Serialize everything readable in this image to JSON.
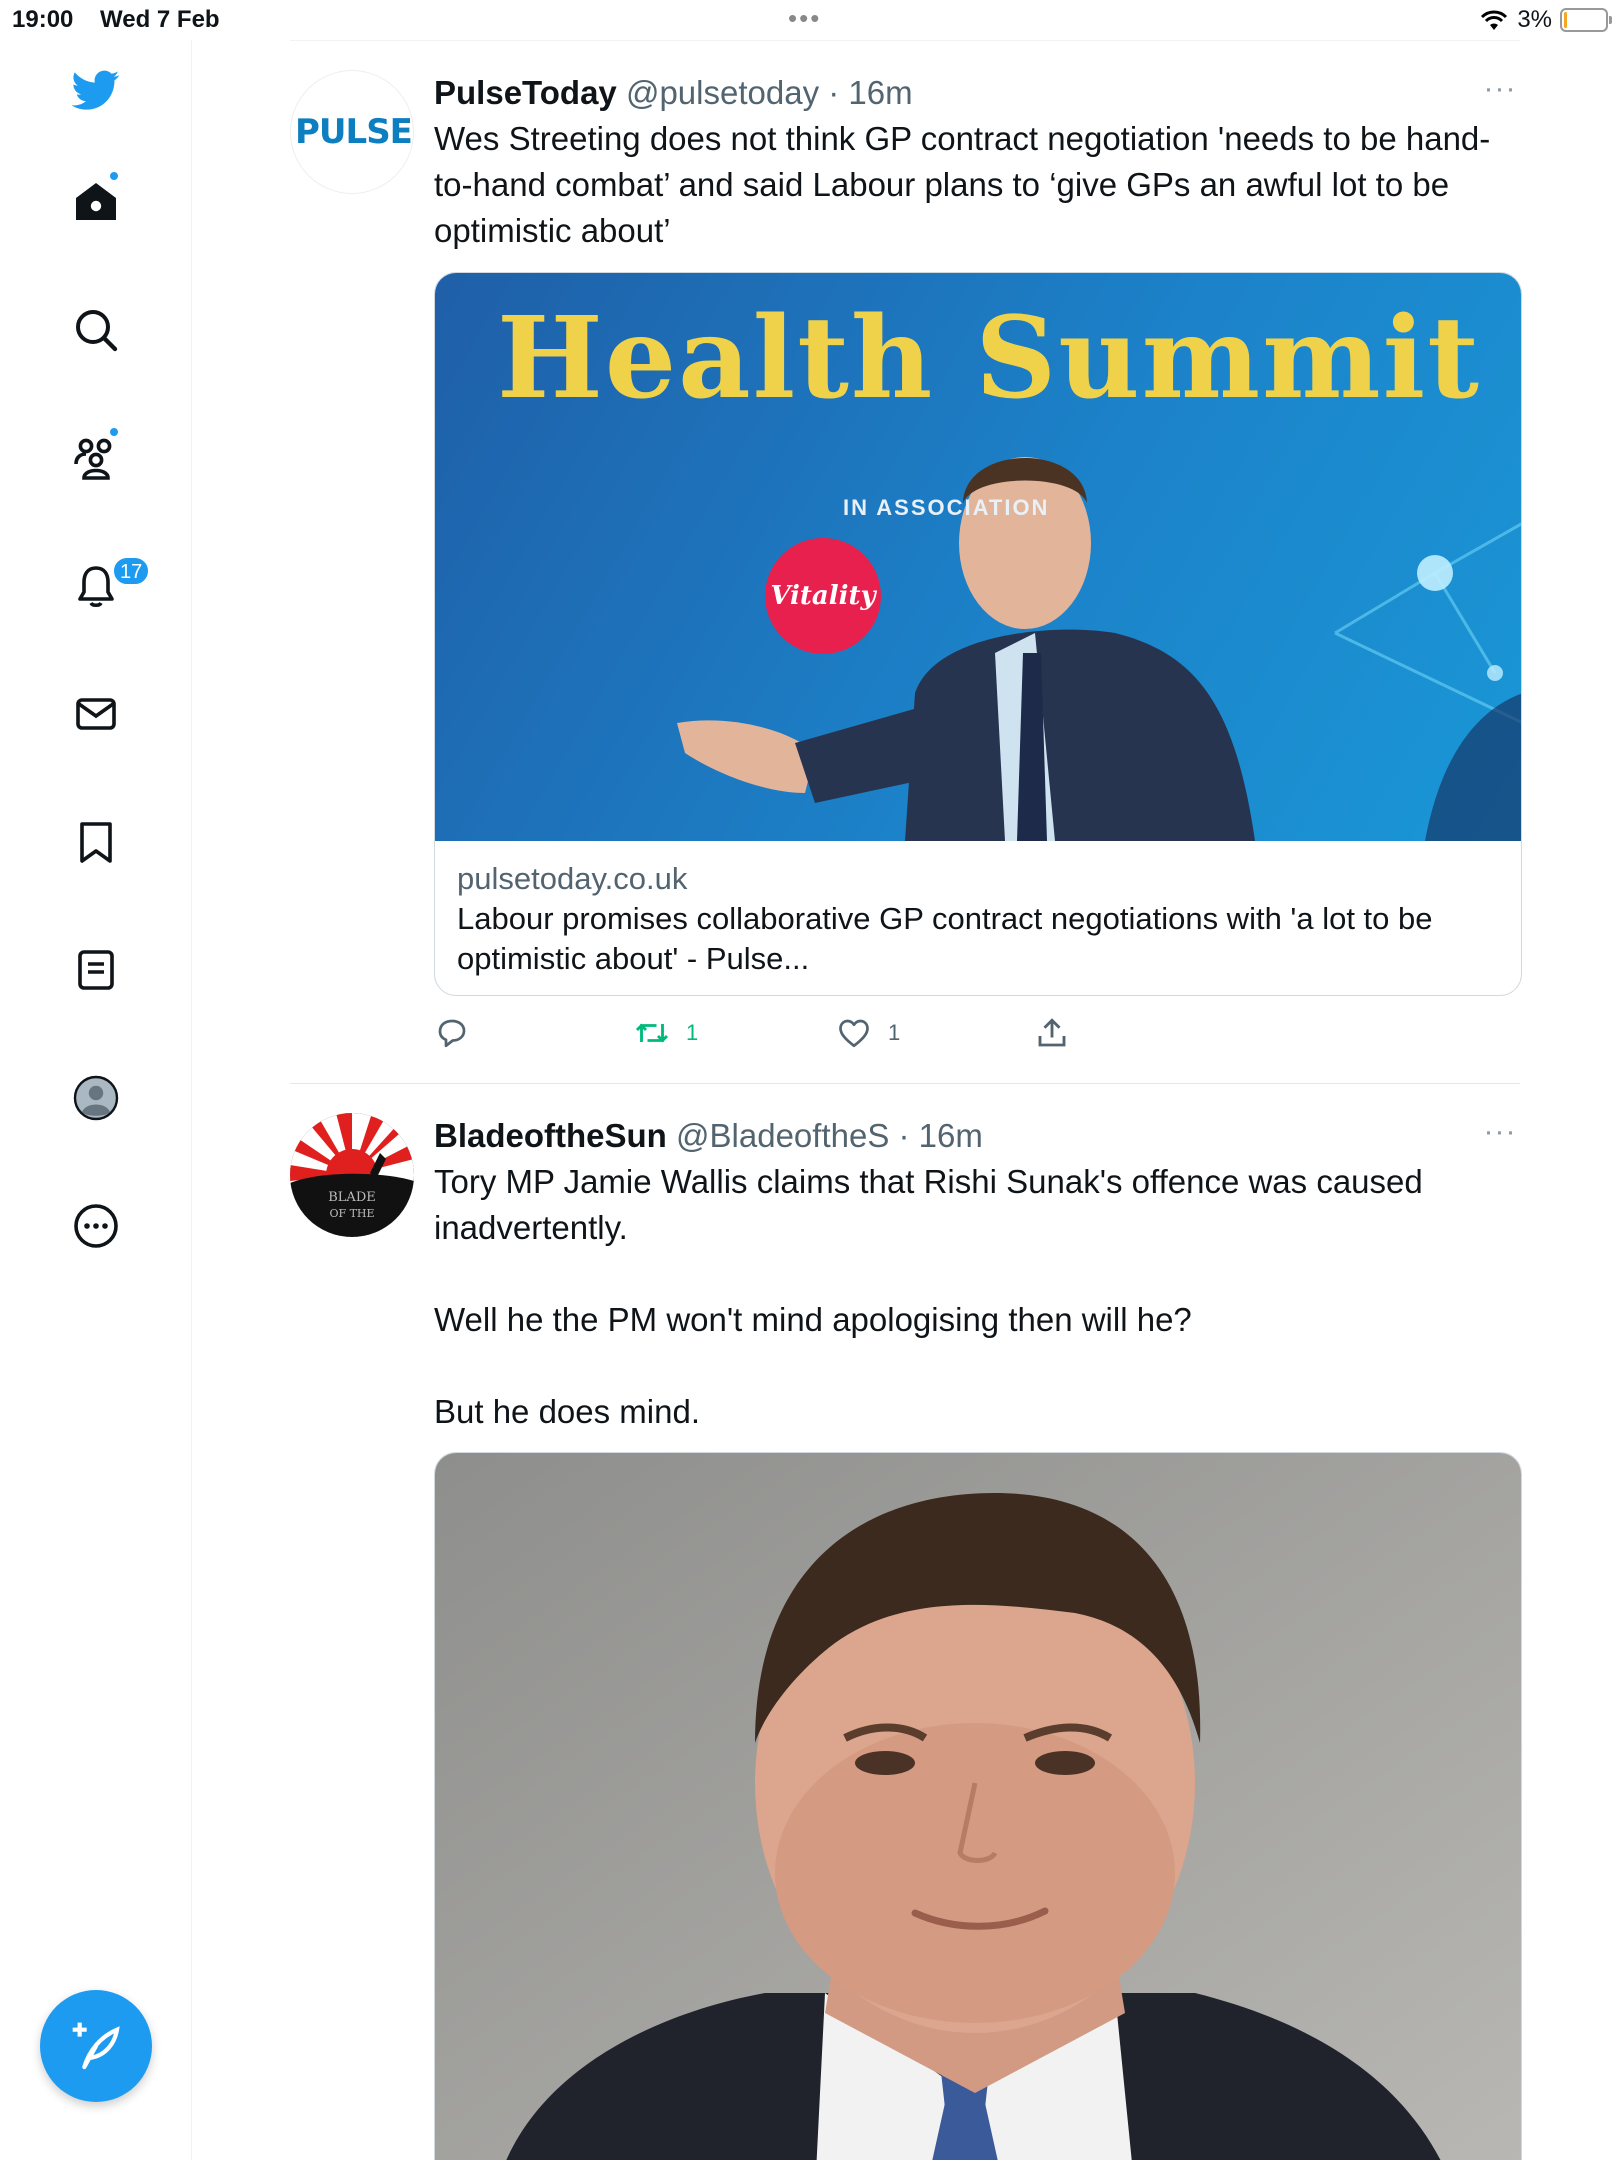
{
  "status_bar": {
    "time": "19:00",
    "date": "Wed 7 Feb",
    "battery": "3%"
  },
  "sidebar": {
    "notifications_badge": "17",
    "items": [
      {
        "name": "home"
      },
      {
        "name": "explore"
      },
      {
        "name": "communities"
      },
      {
        "name": "notifications"
      },
      {
        "name": "messages"
      },
      {
        "name": "bookmarks"
      },
      {
        "name": "lists"
      },
      {
        "name": "profile"
      },
      {
        "name": "more"
      }
    ]
  },
  "tweets": [
    {
      "display_name": "PulseToday",
      "handle": "@pulsetoday",
      "time": "16m",
      "avatar_text": "PULSE",
      "text": "Wes Streeting does not think GP contract negotiation 'needs to be hand-to-hand combat’ and said Labour plans to ‘give GPs an awful lot to be optimistic about’",
      "card": {
        "image_text_1": "Health Summit",
        "image_text_2": "IN ASSOCIATION",
        "image_text_3": "Vitality",
        "domain": "pulsetoday.co.uk",
        "title": "Labour promises collaborative GP contract negotiations with 'a lot to be optimistic about' - Pulse..."
      },
      "replies": "",
      "retweets": "1",
      "likes": "1"
    },
    {
      "display_name": "BladeoftheSun",
      "handle": "@BladeoftheS",
      "time": "16m",
      "avatar_text": "BLADE OF THE",
      "text_paragraphs": [
        "Tory MP Jamie Wallis claims that Rishi Sunak's offence was caused inadvertently.",
        "Well he the PM won't mind apologising then will he?",
        "But he does mind."
      ]
    }
  ],
  "colors": {
    "accent": "#1d9bf0",
    "retweet": "#00ba7c",
    "secondary_text": "#536471"
  }
}
